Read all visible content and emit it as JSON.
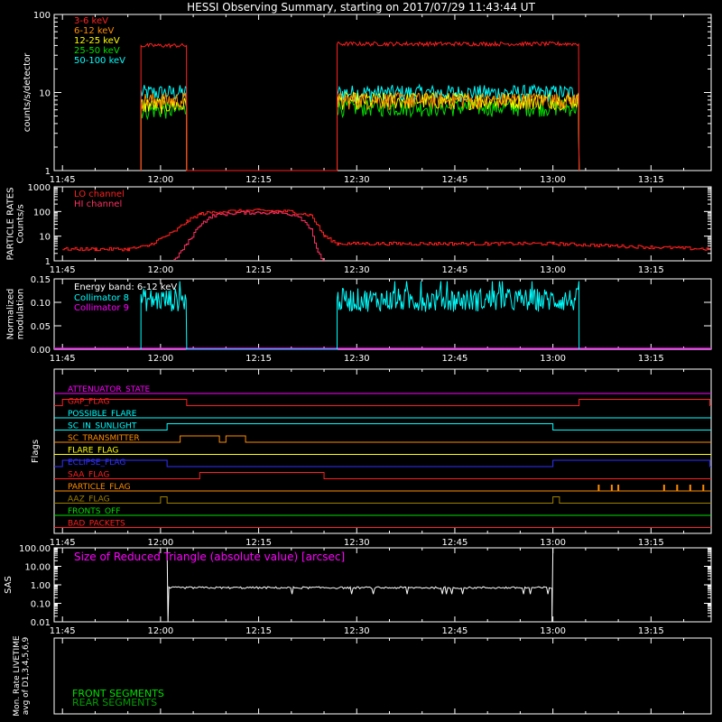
{
  "title": "HESSI Observing Summary, starting on 2017/07/29 11:43:44 UT",
  "time_ticks": [
    "11:45",
    "12:00",
    "12:15",
    "12:30",
    "12:45",
    "13:00",
    "13:15"
  ],
  "colors": {
    "bg": "#000000",
    "axis": "#ffffff",
    "red": "#ff2020",
    "orange": "#ff8c00",
    "yellow": "#ffff00",
    "green": "#00e000",
    "cyan": "#00ffff",
    "magenta": "#ff00ff",
    "blue": "#3030ff",
    "olive": "#a08000",
    "darkgreen": "#00b000"
  },
  "chart_data": [
    {
      "id": "count_rates",
      "type": "line",
      "ylabel": "counts/s/detector",
      "yscale": "log",
      "ylim": [
        1,
        100
      ],
      "ytick_labels": [
        "1",
        "10",
        "100"
      ],
      "xlim": [
        "11:45",
        "13:24"
      ],
      "series": [
        {
          "name": "3-6 keV",
          "color": "#ff2020",
          "segments": [
            {
              "start": "11:57",
              "end": "12:04",
              "level": 40
            },
            {
              "start": "12:27",
              "end": "13:04",
              "level": 42
            }
          ]
        },
        {
          "name": "6-12 keV",
          "color": "#ff8c00",
          "segments": [
            {
              "start": "11:57",
              "end": "12:04",
              "level": 8
            },
            {
              "start": "12:27",
              "end": "13:04",
              "level": 8
            }
          ]
        },
        {
          "name": "12-25 keV",
          "color": "#ffff00",
          "segments": [
            {
              "start": "11:57",
              "end": "12:04",
              "level": 7
            },
            {
              "start": "12:27",
              "end": "13:04",
              "level": 8
            }
          ]
        },
        {
          "name": "25-50 keV",
          "color": "#00e000",
          "segments": [
            {
              "start": "11:57",
              "end": "12:04",
              "level": 6
            },
            {
              "start": "12:27",
              "end": "13:04",
              "level": 6.5
            }
          ]
        },
        {
          "name": "50-100 keV",
          "color": "#00ffff",
          "segments": [
            {
              "start": "11:57",
              "end": "12:04",
              "level": 10
            },
            {
              "start": "12:27",
              "end": "13:04",
              "level": 10
            }
          ]
        }
      ]
    },
    {
      "id": "particle_rates",
      "type": "line",
      "ylabel": "PARTICLE RATES\nCounts/s",
      "yscale": "log",
      "ylim": [
        1,
        1000
      ],
      "ytick_labels": [
        "1",
        "10",
        "100",
        "1000"
      ],
      "series": [
        {
          "name": "LO channel",
          "color": "#ff2020",
          "points": [
            [
              "11:45",
              3
            ],
            [
              "11:50",
              3
            ],
            [
              "11:55",
              3
            ],
            [
              "11:58",
              4
            ],
            [
              "12:00",
              8
            ],
            [
              "12:02",
              15
            ],
            [
              "12:04",
              40
            ],
            [
              "12:06",
              80
            ],
            [
              "12:09",
              100
            ],
            [
              "12:15",
              110
            ],
            [
              "12:20",
              100
            ],
            [
              "12:23",
              70
            ],
            [
              "12:25",
              10
            ],
            [
              "12:27",
              5
            ],
            [
              "12:35",
              5
            ],
            [
              "12:50",
              5
            ],
            [
              "13:00",
              5
            ],
            [
              "13:10",
              4
            ],
            [
              "13:24",
              3
            ]
          ]
        },
        {
          "name": "HI channel",
          "color": "#ff3060",
          "points": [
            [
              "12:02",
              1
            ],
            [
              "12:04",
              5
            ],
            [
              "12:06",
              30
            ],
            [
              "12:08",
              70
            ],
            [
              "12:12",
              90
            ],
            [
              "12:18",
              90
            ],
            [
              "12:21",
              70
            ],
            [
              "12:23",
              20
            ],
            [
              "12:24",
              2
            ],
            [
              "12:25",
              1
            ]
          ]
        }
      ]
    },
    {
      "id": "modulation",
      "type": "line",
      "ylabel": "Normalized\nmodulation",
      "ylim": [
        0,
        0.15
      ],
      "ytick_labels": [
        "0.00",
        "0.05",
        "0.10",
        "0.15"
      ],
      "annotation": "Energy band: 6-12 keV",
      "series": [
        {
          "name": "Collimator 8",
          "color": "#00ffff",
          "segments": [
            {
              "start": "11:57",
              "end": "12:04",
              "level": 0.105
            },
            {
              "start": "12:27",
              "end": "13:04",
              "level": 0.105
            }
          ]
        },
        {
          "name": "Collimator 9",
          "color": "#ff00ff",
          "level": 0.0
        }
      ]
    },
    {
      "id": "flags",
      "type": "timeline",
      "ylabel": "Flags",
      "series": [
        {
          "name": "ATTENUATOR_STATE",
          "color": "#ff00ff",
          "high_intervals": []
        },
        {
          "name": "GAP_FLAG",
          "color": "#ff2020",
          "high_intervals": [
            [
              "11:45",
              "12:04"
            ],
            [
              "13:04",
              "13:24"
            ]
          ]
        },
        {
          "name": "POSSIBLE_FLARE",
          "color": "#00ffff",
          "high_intervals": []
        },
        {
          "name": "SC_IN_SUNLIGHT",
          "color": "#00ffff",
          "high_intervals": [
            [
              "12:01",
              "13:00"
            ]
          ]
        },
        {
          "name": "SC_TRANSMITTER",
          "color": "#ff8c00",
          "high_intervals": [
            [
              "12:03",
              "12:09"
            ],
            [
              "12:10",
              "12:13"
            ]
          ]
        },
        {
          "name": "FLARE_FLAG",
          "color": "#ffff00",
          "high_intervals": []
        },
        {
          "name": "ECLIPSE_FLAG",
          "color": "#3030ff",
          "high_intervals": [
            [
              "11:45",
              "12:01"
            ],
            [
              "13:00",
              "13:24"
            ]
          ]
        },
        {
          "name": "SAA_FLAG",
          "color": "#ff2020",
          "high_intervals": [
            [
              "12:06",
              "12:25"
            ]
          ]
        },
        {
          "name": "PARTICLE_FLAG",
          "color": "#ff8c00",
          "high_intervals": [
            [
              "13:07",
              "13:07"
            ],
            [
              "13:09",
              "13:09"
            ],
            [
              "13:10",
              "13:10"
            ],
            [
              "13:17",
              "13:17"
            ],
            [
              "13:19",
              "13:19"
            ],
            [
              "13:21",
              "13:21"
            ],
            [
              "13:23",
              "13:23"
            ]
          ]
        },
        {
          "name": "AAZ_FLAG",
          "color": "#a08000",
          "high_intervals": [
            [
              "12:00",
              "12:01"
            ],
            [
              "13:00",
              "13:01"
            ]
          ]
        },
        {
          "name": "FRONTS_OFF",
          "color": "#00e000",
          "high_intervals": []
        },
        {
          "name": "BAD_PACKETS",
          "color": "#ff2020",
          "high_intervals": []
        }
      ]
    },
    {
      "id": "sas",
      "type": "line",
      "ylabel": "SAS",
      "yscale": "log",
      "ylim": [
        0.01,
        100
      ],
      "ytick_labels": [
        "0.01",
        "0.10",
        "1.00",
        "10.00",
        "100.00"
      ],
      "annotation": "Size of Reduced Triangle (absolute value) [arcsec]",
      "series": [
        {
          "name": "",
          "color": "#ffffff",
          "segments": [
            {
              "start": "12:01",
              "end": "13:00",
              "level": 0.7
            }
          ]
        }
      ]
    },
    {
      "id": "livetime",
      "type": "line",
      "ylabel": "Mon. Rate LIVETIME\navg of D1,3,4,5,6,9",
      "series": [
        {
          "name": "FRONT SEGMENTS",
          "color": "#00e000"
        },
        {
          "name": "REAR SEGMENTS",
          "color": "#00a000"
        }
      ]
    }
  ]
}
